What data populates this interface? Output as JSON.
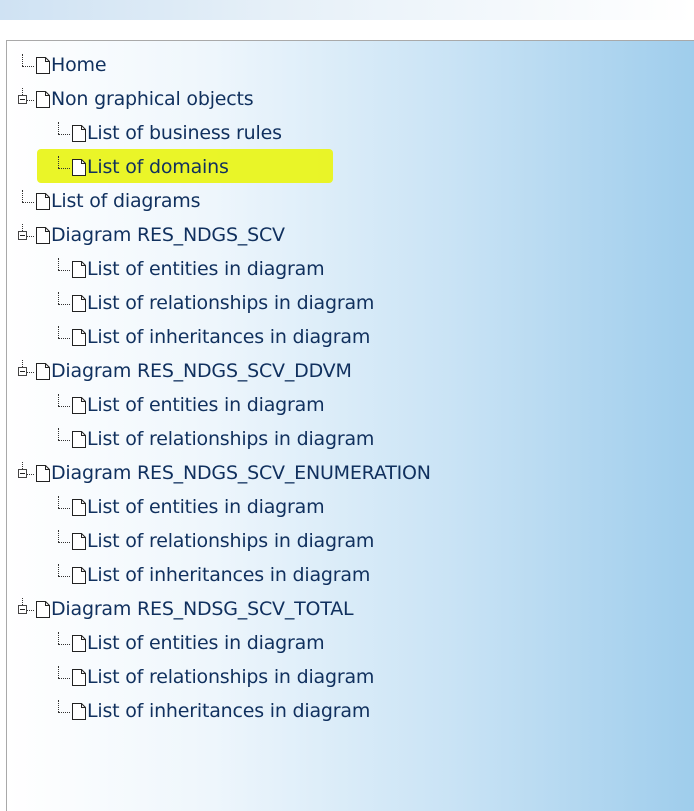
{
  "tree": {
    "items": [
      {
        "label": "Home",
        "level": 0,
        "expander": false
      },
      {
        "label": "Non graphical objects",
        "level": 0,
        "expander": true
      },
      {
        "label": "List of business rules",
        "level": 1,
        "expander": false
      },
      {
        "label": "List of domains",
        "level": 1,
        "expander": false,
        "highlighted": true
      },
      {
        "label": "List of diagrams",
        "level": 0,
        "expander": false
      },
      {
        "label": "Diagram RES_NDGS_SCV",
        "level": 0,
        "expander": true
      },
      {
        "label": "List of entities in diagram",
        "level": 1,
        "expander": false
      },
      {
        "label": "List of relationships in diagram",
        "level": 1,
        "expander": false
      },
      {
        "label": "List of inheritances in diagram",
        "level": 1,
        "expander": false
      },
      {
        "label": "Diagram RES_NDGS_SCV_DDVM",
        "level": 0,
        "expander": true
      },
      {
        "label": "List of entities in diagram",
        "level": 1,
        "expander": false
      },
      {
        "label": "List of relationships in diagram",
        "level": 1,
        "expander": false
      },
      {
        "label": "Diagram RES_NDGS_SCV_ENUMERATION",
        "level": 0,
        "expander": true
      },
      {
        "label": "List of entities in diagram",
        "level": 1,
        "expander": false
      },
      {
        "label": "List of relationships in diagram",
        "level": 1,
        "expander": false
      },
      {
        "label": "List of inheritances in diagram",
        "level": 1,
        "expander": false
      },
      {
        "label": "Diagram RES_NDSG_SCV_TOTAL",
        "level": 0,
        "expander": true
      },
      {
        "label": "List of entities in diagram",
        "level": 1,
        "expander": false
      },
      {
        "label": "List of relationships in diagram",
        "level": 1,
        "expander": false
      },
      {
        "label": "List of inheritances in diagram",
        "level": 1,
        "expander": false
      }
    ]
  },
  "colors": {
    "link_text": "#10305e",
    "highlight": "#e9f41c",
    "panel_gradient_end": "#9fcdec"
  },
  "icons": {
    "node": "page-icon",
    "expander": "collapse-box-icon"
  }
}
